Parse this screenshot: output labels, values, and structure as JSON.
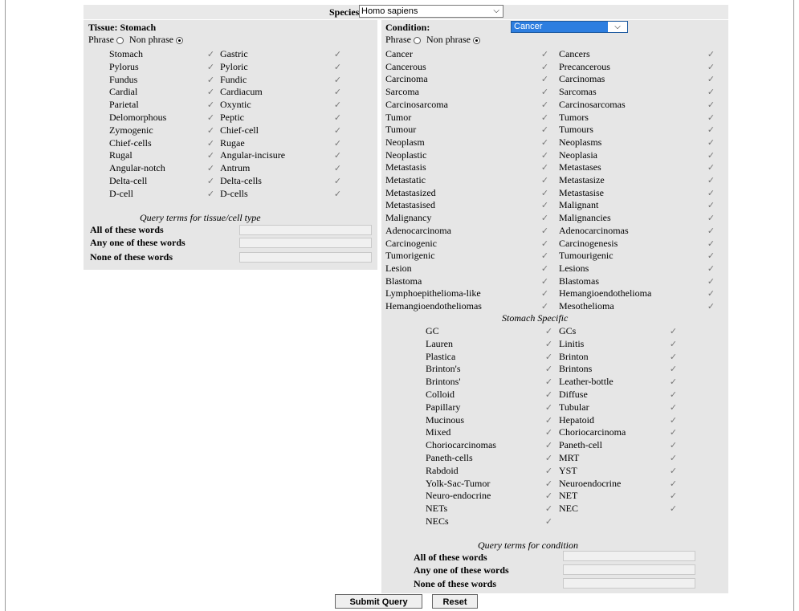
{
  "species": {
    "label": "Species:",
    "selected": "Homo sapiens"
  },
  "tissue": {
    "title": "Tissue: Stomach",
    "phrase_label": "Phrase",
    "non_phrase_label": "Non phrase",
    "terms": [
      [
        "Stomach",
        "Gastric"
      ],
      [
        "Pylorus",
        "Pyloric"
      ],
      [
        "Fundus",
        "Fundic"
      ],
      [
        "Cardial",
        "Cardiacum"
      ],
      [
        "Parietal",
        "Oxyntic"
      ],
      [
        "Delomorphous",
        "Peptic"
      ],
      [
        "Zymogenic",
        "Chief-cell"
      ],
      [
        "Chief-cells",
        "Rugae"
      ],
      [
        "Rugal",
        "Angular-incisure"
      ],
      [
        "Angular-notch",
        "Antrum"
      ],
      [
        "Delta-cell",
        "Delta-cells"
      ],
      [
        "D-cell",
        "D-cells"
      ]
    ],
    "query_title": "Query terms for tissue/cell type",
    "all_label": "All of these words",
    "any_label": "Any one of these words",
    "none_label": "None of these words"
  },
  "condition": {
    "title": "Condition:",
    "selected": "Cancer",
    "phrase_label": "Phrase",
    "non_phrase_label": "Non phrase",
    "terms": [
      [
        "Cancer",
        "Cancers"
      ],
      [
        "Cancerous",
        "Precancerous"
      ],
      [
        "Carcinoma",
        "Carcinomas"
      ],
      [
        "Sarcoma",
        "Sarcomas"
      ],
      [
        "Carcinosarcoma",
        "Carcinosarcomas"
      ],
      [
        "Tumor",
        "Tumors"
      ],
      [
        "Tumour",
        "Tumours"
      ],
      [
        "Neoplasm",
        "Neoplasms"
      ],
      [
        "Neoplastic",
        "Neoplasia"
      ],
      [
        "Metastasis",
        "Metastases"
      ],
      [
        "Metastatic",
        "Metastasize"
      ],
      [
        "Metastasized",
        "Metastasise"
      ],
      [
        "Metastasised",
        "Malignant"
      ],
      [
        "Malignancy",
        "Malignancies"
      ],
      [
        "Adenocarcinoma",
        "Adenocarcinomas"
      ],
      [
        "Carcinogenic",
        "Carcinogenesis"
      ],
      [
        "Tumorigenic",
        "Tumourigenic"
      ],
      [
        "Lesion",
        "Lesions"
      ],
      [
        "Blastoma",
        "Blastomas"
      ],
      [
        "Lymphoepithelioma-like",
        "Hemangioendothelioma"
      ],
      [
        "Hemangioendotheliomas",
        "Mesothelioma"
      ]
    ],
    "specific_title": "Stomach Specific",
    "specific_terms": [
      [
        "GC",
        "GCs"
      ],
      [
        "Lauren",
        "Linitis"
      ],
      [
        "Plastica",
        "Brinton"
      ],
      [
        "Brinton's",
        "Brintons"
      ],
      [
        "Brintons'",
        "Leather-bottle"
      ],
      [
        "Colloid",
        "Diffuse"
      ],
      [
        "Papillary",
        "Tubular"
      ],
      [
        "Mucinous",
        "Hepatoid"
      ],
      [
        "Mixed",
        "Choriocarcinoma"
      ],
      [
        "Choriocarcinomas",
        "Paneth-cell"
      ],
      [
        "Paneth-cells",
        "MRT"
      ],
      [
        "Rabdoid",
        "YST"
      ],
      [
        "Yolk-Sac-Tumor",
        "Neuroendocrine"
      ],
      [
        "Neuro-endocrine",
        "NET"
      ],
      [
        "NETs",
        "NEC"
      ],
      [
        "NECs",
        ""
      ]
    ],
    "query_title": "Query terms for condition",
    "all_label": "All of these words",
    "any_label": "Any one of these words",
    "none_label": "None of these words"
  },
  "buttons": {
    "submit": "Submit Query",
    "reset": "Reset"
  },
  "check_glyph": "✓"
}
